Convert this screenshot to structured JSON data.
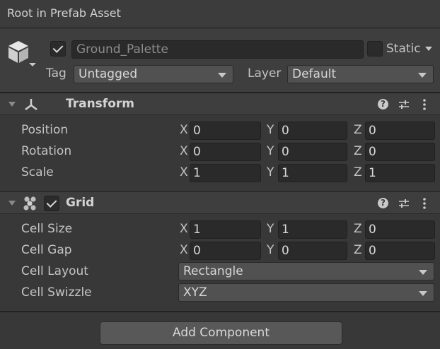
{
  "window": {
    "title": "Root in Prefab Asset"
  },
  "gameobject": {
    "icon": "cube-icon",
    "active": true,
    "name": "Ground_Palette",
    "static_label": "Static",
    "tag_label": "Tag",
    "tag_value": "Untagged",
    "layer_label": "Layer",
    "layer_value": "Default"
  },
  "transform": {
    "title": "Transform",
    "icon": "transform-axes-icon",
    "rows": [
      {
        "label": "Position",
        "x": "0",
        "y": "0",
        "z": "0"
      },
      {
        "label": "Rotation",
        "x": "0",
        "y": "0",
        "z": "0"
      },
      {
        "label": "Scale",
        "x": "1",
        "y": "1",
        "z": "1"
      }
    ]
  },
  "grid": {
    "title": "Grid",
    "icon": "grid-dots-icon",
    "enabled": true,
    "rows": [
      {
        "label": "Cell Size",
        "x": "1",
        "y": "1",
        "z": "0"
      },
      {
        "label": "Cell Gap",
        "x": "0",
        "y": "0",
        "z": "0"
      }
    ],
    "cell_layout_label": "Cell Layout",
    "cell_layout_value": "Rectangle",
    "cell_swizzle_label": "Cell Swizzle",
    "cell_swizzle_value": "XYZ"
  },
  "axes": {
    "x": "X",
    "y": "Y",
    "z": "Z"
  },
  "help_glyph": "?",
  "add_component_label": "Add Component",
  "colors": {
    "background": "#383838",
    "header": "#3e3e3e",
    "field": "#2a2a2a",
    "button": "#585858"
  }
}
